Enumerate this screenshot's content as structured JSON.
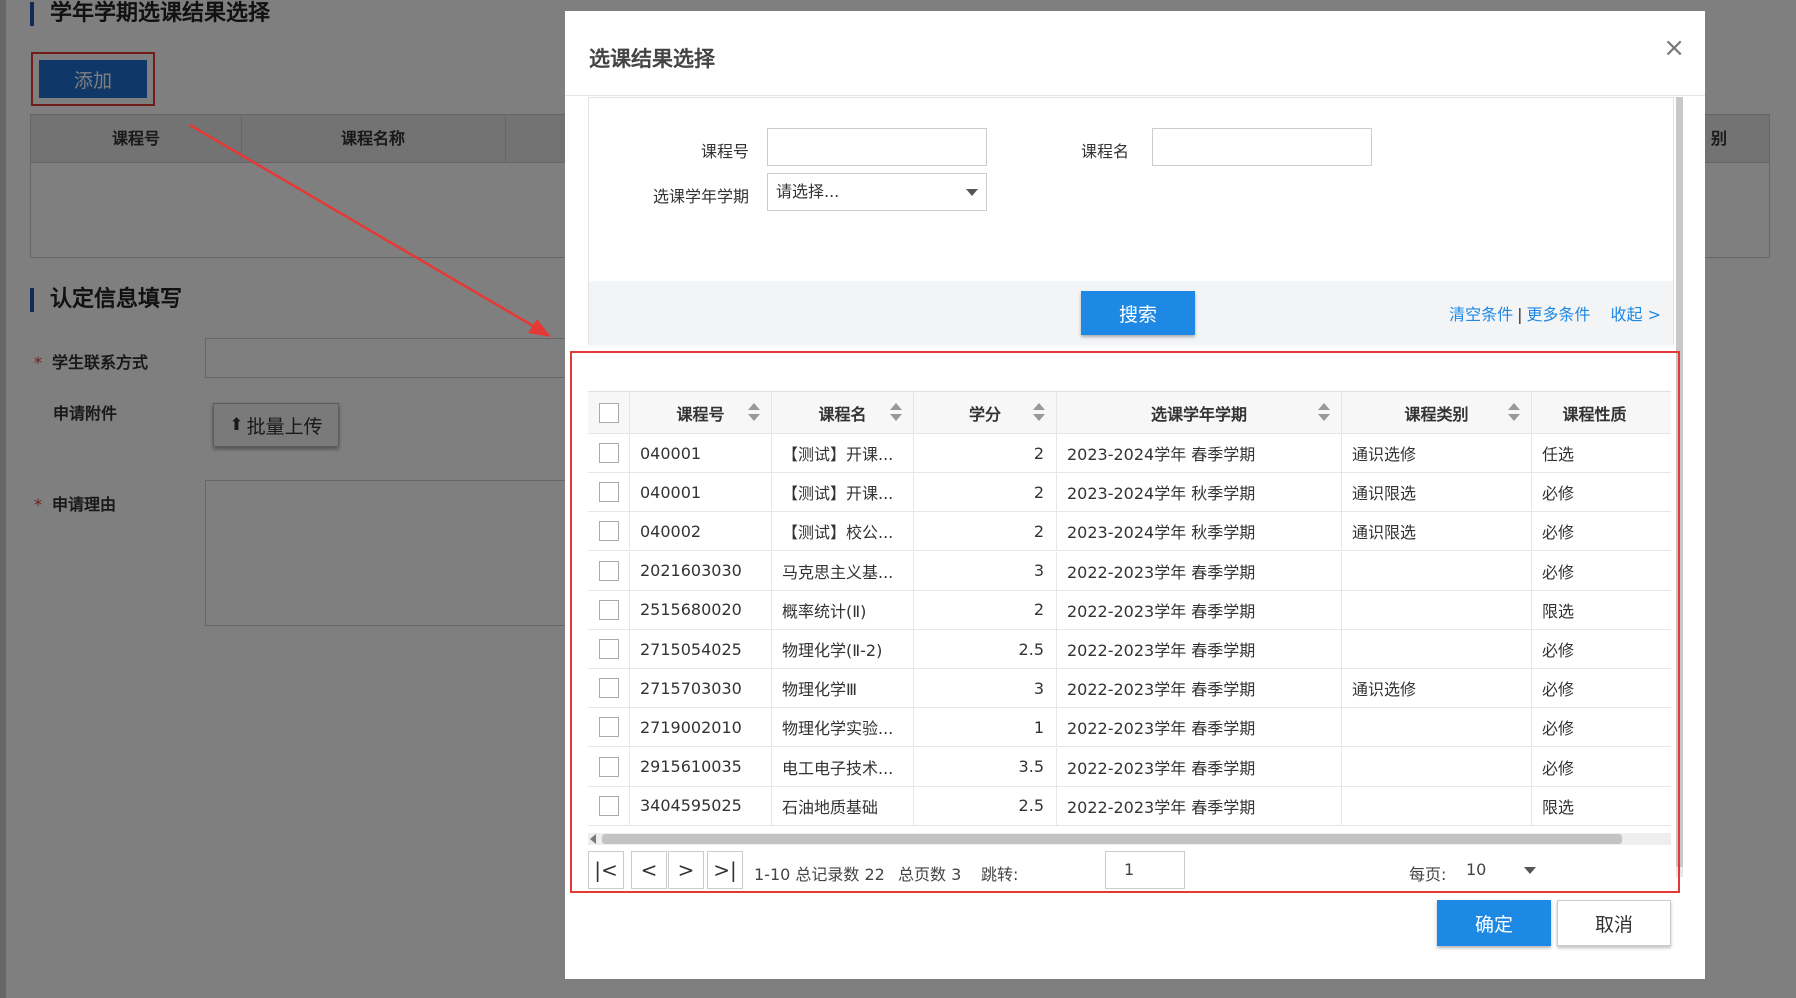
{
  "background": {
    "section1_title": "学年学期选课结果选择",
    "add_button": "添加",
    "table_headers": [
      "课程号",
      "课程名称",
      "别"
    ],
    "section2_title": "认定信息填写",
    "contact_label": "学生联系方式",
    "attachment_label": "申请附件",
    "upload_button": "批量上传",
    "reason_label": "申请理由",
    "required_mark": "*"
  },
  "modal": {
    "title": "选课结果选择",
    "close": "×",
    "search": {
      "course_no_label": "课程号",
      "course_name_label": "课程名",
      "term_label": "选课学年学期",
      "term_placeholder": "请选择...",
      "search_button": "搜索",
      "clear_link": "清空条件",
      "separator": "|",
      "more_link": "更多条件",
      "collapse_link": "收起 >"
    },
    "table": {
      "headers": {
        "course_no": "课程号",
        "course_name": "课程名",
        "credit": "学分",
        "term": "选课学年学期",
        "category": "课程类别",
        "nature": "课程性质"
      },
      "rows": [
        {
          "no": "040001",
          "name": "【测试】开课...",
          "credit": "2",
          "term": "2023-2024学年 春季学期",
          "category": "通识选修",
          "nature": "任选"
        },
        {
          "no": "040001",
          "name": "【测试】开课...",
          "credit": "2",
          "term": "2023-2024学年 秋季学期",
          "category": "通识限选",
          "nature": "必修"
        },
        {
          "no": "040002",
          "name": "【测试】校公...",
          "credit": "2",
          "term": "2023-2024学年 秋季学期",
          "category": "通识限选",
          "nature": "必修"
        },
        {
          "no": "2021603030",
          "name": "马克思主义基...",
          "credit": "3",
          "term": "2022-2023学年 春季学期",
          "category": "",
          "nature": "必修"
        },
        {
          "no": "2515680020",
          "name": "概率统计(Ⅱ)",
          "credit": "2",
          "term": "2022-2023学年 春季学期",
          "category": "",
          "nature": "限选"
        },
        {
          "no": "2715054025",
          "name": "物理化学(Ⅱ-2)",
          "credit": "2.5",
          "term": "2022-2023学年 春季学期",
          "category": "",
          "nature": "必修"
        },
        {
          "no": "2715703030",
          "name": "物理化学Ⅲ",
          "credit": "3",
          "term": "2022-2023学年 春季学期",
          "category": "通识选修",
          "nature": "必修"
        },
        {
          "no": "2719002010",
          "name": "物理化学实验...",
          "credit": "1",
          "term": "2022-2023学年 春季学期",
          "category": "",
          "nature": "必修"
        },
        {
          "no": "2915610035",
          "name": "电工电子技术...",
          "credit": "3.5",
          "term": "2022-2023学年 春季学期",
          "category": "",
          "nature": "必修"
        },
        {
          "no": "3404595025",
          "name": "石油地质基础",
          "credit": "2.5",
          "term": "2022-2023学年 春季学期",
          "category": "",
          "nature": "限选"
        }
      ]
    },
    "pager": {
      "first": "|<",
      "prev": "<",
      "next": ">",
      "last": ">|",
      "records_text": "1-10 总记录数 22",
      "pages_text": "总页数 3",
      "jump_label": "跳转:",
      "jump_value": "1",
      "page_size_label": "每页:",
      "page_size_value": "10"
    },
    "ok_button": "确定",
    "cancel_button": "取消"
  },
  "colors": {
    "primary": "#1e88e5",
    "highlight_border": "#e53935",
    "section_accent": "#1a57a8"
  }
}
